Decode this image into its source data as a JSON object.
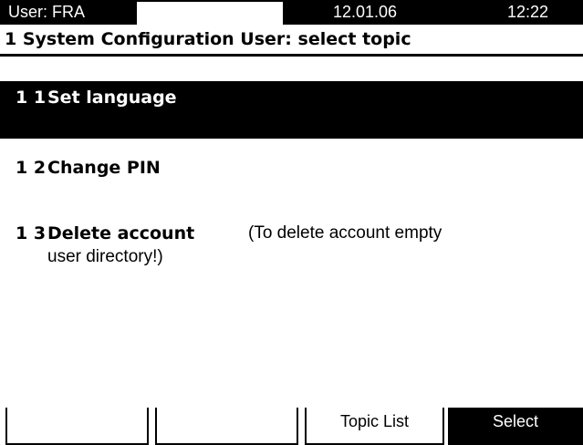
{
  "status_bar": {
    "user": "User: FRA",
    "date": "12.01.06",
    "time": "12:22"
  },
  "page_title": "1 System Configuration User: select topic",
  "menu": {
    "items": [
      {
        "number": "1 1",
        "label": "Set language",
        "selected": true
      },
      {
        "number": "1 2",
        "label": "Change PIN",
        "selected": false
      },
      {
        "number": "1 3",
        "label": "Delete account",
        "note_line1": "(To delete account empty",
        "note_line2": "user directory!)",
        "selected": false
      }
    ]
  },
  "softkeys": {
    "key1": "",
    "key2": "",
    "key3": "Topic List",
    "key4": "Select"
  },
  "colors": {
    "foreground": "#000000",
    "background": "#ffffff",
    "highlight": "#000000"
  }
}
